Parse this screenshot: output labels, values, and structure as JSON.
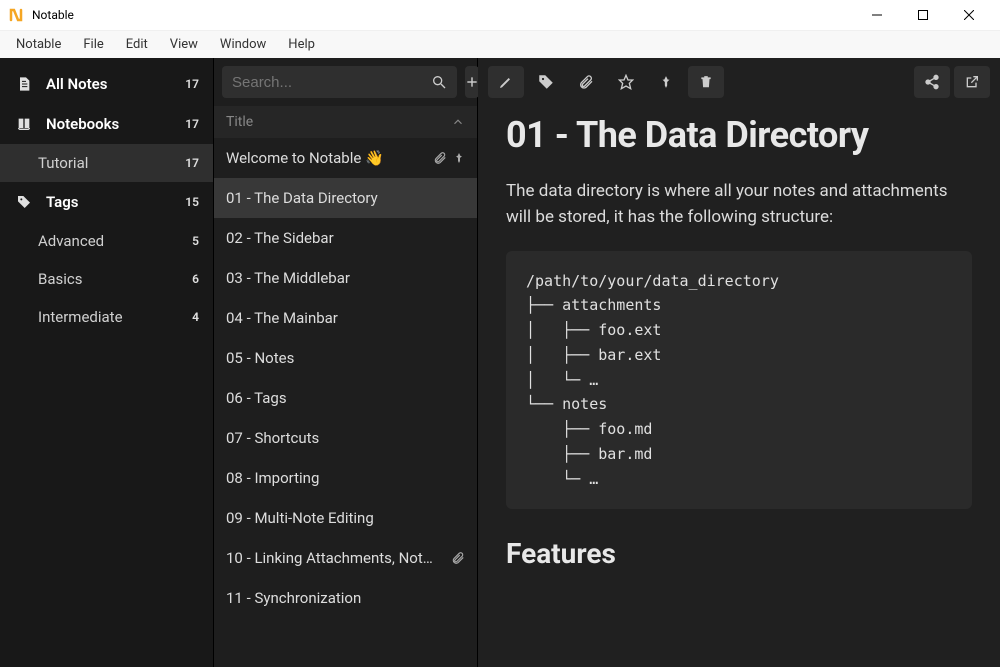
{
  "titlebar": {
    "title": "Notable"
  },
  "menubar": [
    "Notable",
    "File",
    "Edit",
    "View",
    "Window",
    "Help"
  ],
  "sidebar": {
    "items": [
      {
        "label": "All Notes",
        "count": "17",
        "icon": "file",
        "bold": true
      },
      {
        "label": "Notebooks",
        "count": "17",
        "icon": "book",
        "bold": true
      },
      {
        "label": "Tutorial",
        "count": "17",
        "child": true,
        "selected": true
      },
      {
        "label": "Tags",
        "count": "15",
        "icon": "tag",
        "bold": true
      },
      {
        "label": "Advanced",
        "count": "5",
        "child": true
      },
      {
        "label": "Basics",
        "count": "6",
        "child": true
      },
      {
        "label": "Intermediate",
        "count": "4",
        "child": true
      }
    ]
  },
  "middle": {
    "search_placeholder": "Search...",
    "sort_label": "Title",
    "notes": [
      {
        "label": "Welcome to Notable 👋",
        "attach": true,
        "pin": true
      },
      {
        "label": "01 - The Data Directory",
        "selected": true
      },
      {
        "label": "02 - The Sidebar"
      },
      {
        "label": "03 - The Middlebar"
      },
      {
        "label": "04 - The Mainbar"
      },
      {
        "label": "05 - Notes"
      },
      {
        "label": "06 - Tags"
      },
      {
        "label": "07 - Shortcuts"
      },
      {
        "label": "08 - Importing"
      },
      {
        "label": "09 - Multi-Note Editing"
      },
      {
        "label": "10 - Linking Attachments, Not…",
        "attach": true
      },
      {
        "label": "11 - Synchronization"
      }
    ]
  },
  "main": {
    "title": "01 - The Data Directory",
    "para": "The data directory is where all your notes and attachments will be stored, it has the following structure:",
    "code": "/path/to/your/data_directory\n├── attachments\n│   ├── foo.ext\n│   ├── bar.ext\n│   └─ …\n└── notes\n    ├── foo.md\n    ├── bar.md\n    └─ …",
    "h2": "Features"
  }
}
